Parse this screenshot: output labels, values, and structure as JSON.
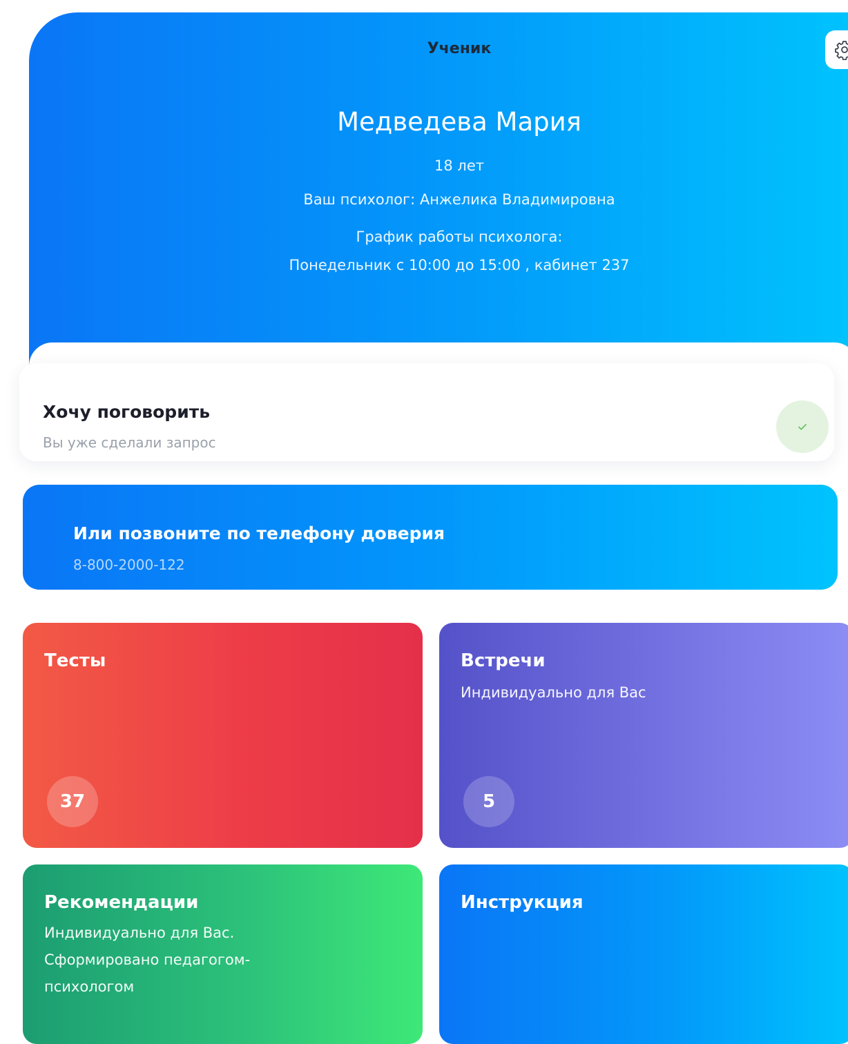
{
  "header": {
    "role": "Ученик",
    "settings_icon": "gear-icon"
  },
  "profile": {
    "name": "Медведева Мария",
    "age": "18 лет",
    "psychologist": "Ваш психолог: Анжелика Владимировна",
    "schedule_label": "График работы психолога:",
    "schedule": "Понедельник с 10:00 до 15:00 , кабинет 237"
  },
  "request_card": {
    "title": "Хочу поговорить",
    "subtitle": "Вы уже сделали запрос",
    "status_icon": "check-icon",
    "status_color": "#6cc06a"
  },
  "hotline_card": {
    "title": "Или позвоните по телефону доверия",
    "phone": "8-800-2000-122"
  },
  "tiles": {
    "tests": {
      "title": "Тесты",
      "count": "37"
    },
    "meetings": {
      "title": "Встречи",
      "subtitle": "Индивидуально для Вас",
      "count": "5"
    },
    "recommendations": {
      "title": "Рекомендации",
      "lines": [
        "Индивидуально для Вас.",
        "Сформировано педагогом-",
        "психологом"
      ]
    },
    "instructions": {
      "title": "Инструкция"
    }
  },
  "colors": {
    "blue_start": "#0a76f6",
    "blue_end": "#00c3fd",
    "red_start": "#f25a45",
    "red_end": "#e5304a",
    "purple_start": "#5552c9",
    "purple_end": "#8d8df5",
    "green_start": "#1c9d72",
    "green_end": "#3ee878"
  }
}
